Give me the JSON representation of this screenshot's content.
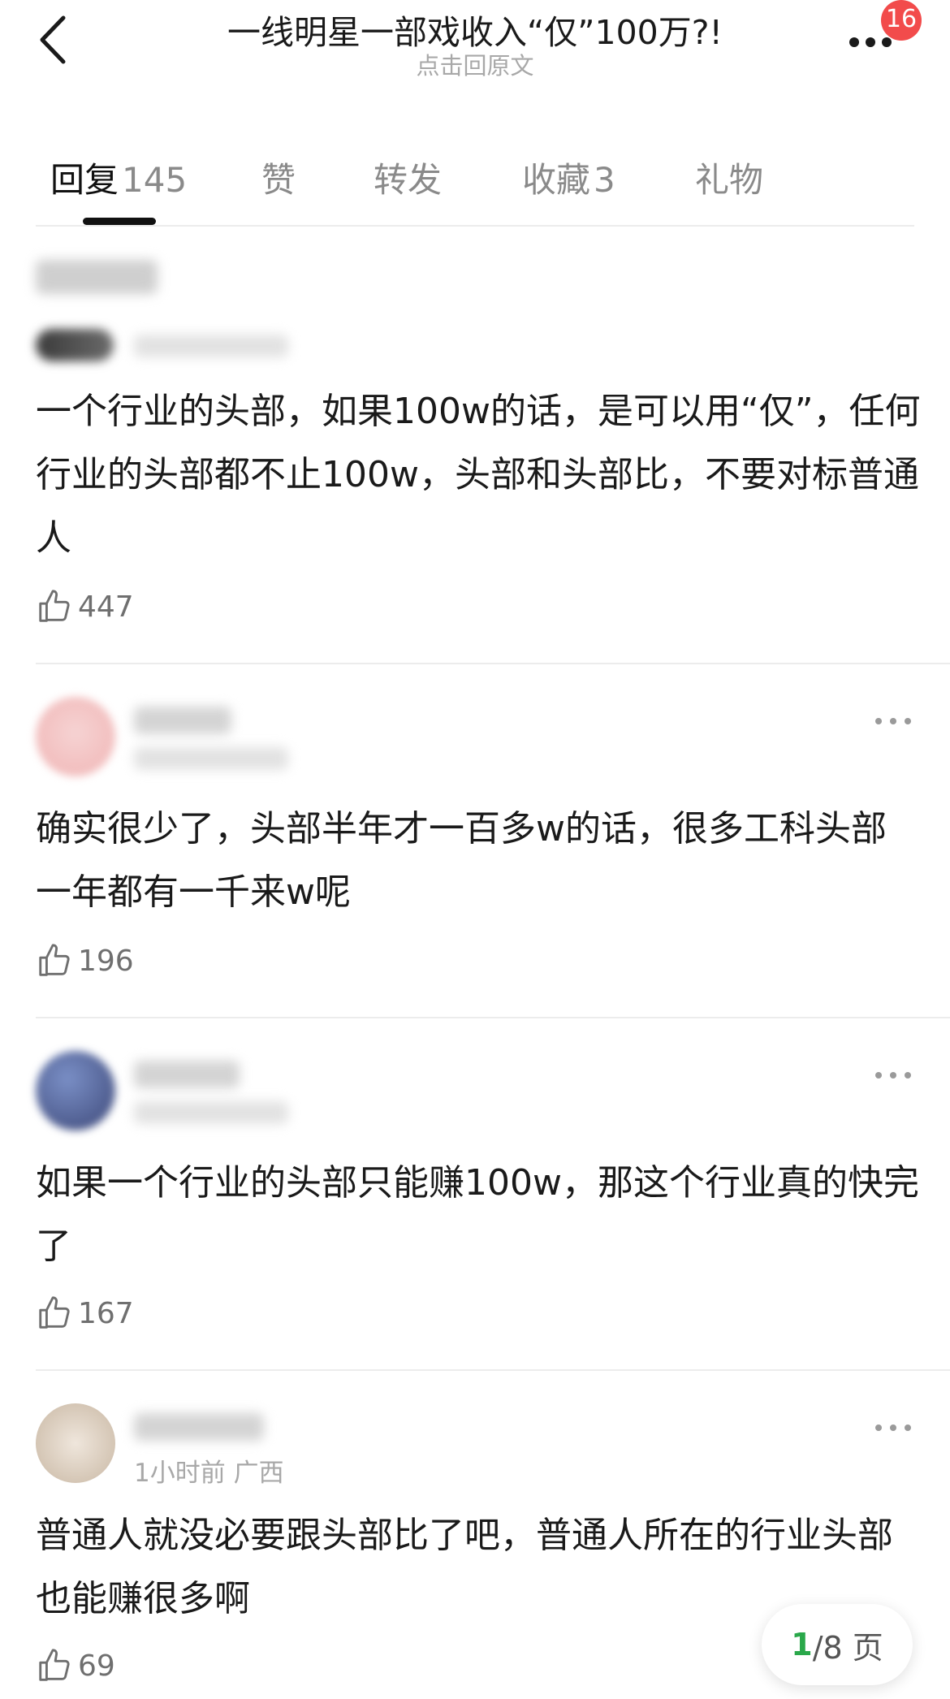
{
  "header": {
    "title": "一线明星一部戏收入“仅”100万?!",
    "subtitle": "点击回原文",
    "notification_count": "16",
    "back_icon": "chevron-left-icon",
    "more_icon": "more-horizontal-icon"
  },
  "tabs": [
    {
      "label": "回复",
      "count": "145",
      "active": true
    },
    {
      "label": "赞",
      "count": "",
      "active": false
    },
    {
      "label": "转发",
      "count": "",
      "active": false
    },
    {
      "label": "收藏",
      "count": "3",
      "active": false
    },
    {
      "label": "礼物",
      "count": "",
      "active": false
    }
  ],
  "comments": [
    {
      "text": "一个行业的头部，如果100w的话，是可以用“仅”，任何行业的头部都不止100w，头部和头部比，不要对标普通人",
      "likes": "447"
    },
    {
      "text": "确实很少了，头部半年才一百多w的话，很多工科头部一年都有一千来w呢",
      "likes": "196"
    },
    {
      "text": "如果一个行业的头部只能赚100w，那这个行业真的快完了",
      "likes": "167"
    },
    {
      "meta": "1小时前 广西",
      "text": "普通人就没必要跟头部比了吧，普通人所在的行业头部也能赚很多啊",
      "likes": "69"
    }
  ],
  "pager": {
    "current": "1",
    "total_text": "/8 页"
  },
  "colors": {
    "accent_green": "#2aa84a",
    "badge_red": "#f24b4b",
    "text_gray": "#8a8a8a"
  }
}
